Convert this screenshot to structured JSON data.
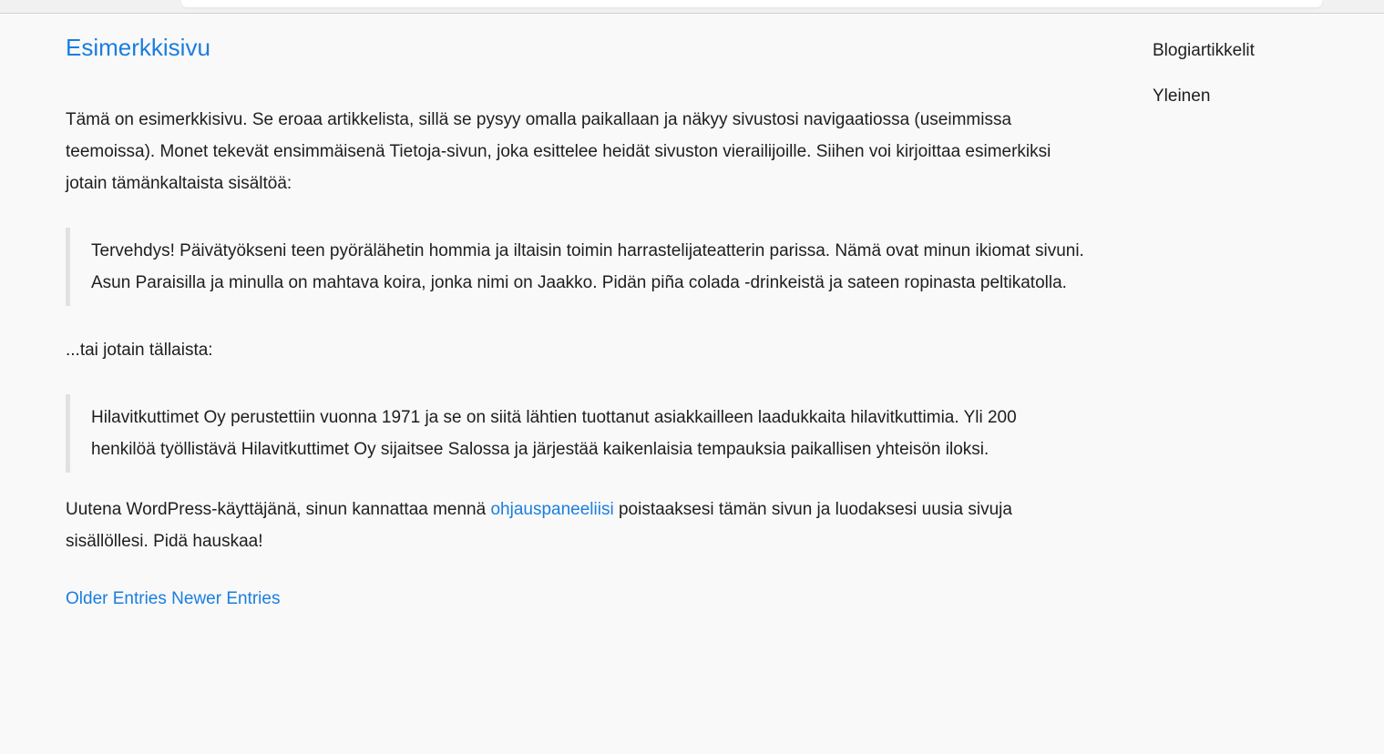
{
  "page": {
    "title": "Esimerkkisivu"
  },
  "content": {
    "intro": "Tämä on esimerkkisivu. Se eroaa artikkelista, sillä se pysyy omalla paikallaan ja näkyy sivustosi navigaatiossa (useimmissa teemoissa). Monet tekevät ensimmäisenä Tietoja-sivun, joka esittelee heidät sivuston vierailijoille. Siihen voi kirjoittaa esimerkiksi jotain tämänkaltaista sisältöä:",
    "quote1": "Tervehdys! Päivätyökseni teen pyörälähetin hommia ja iltaisin toimin harrastelijateatterin parissa. Nämä ovat minun ikiomat sivuni. Asun Paraisilla ja minulla on mahtava koira, jonka nimi on Jaakko. Pidän piña colada -drinkeistä ja sateen ropinasta peltikatolla.",
    "or_text": "...tai jotain tällaista:",
    "quote2": "Hilavitkuttimet Oy perustettiin vuonna 1971 ja se on siitä lähtien tuottanut asiakkailleen laadukkaita hilavitkuttimia. Yli 200 henkilöä työllistävä Hilavitkuttimet Oy sijaitsee Salossa ja järjestää kaikenlaisia tempauksia paikallisen yhteisön iloksi.",
    "outro_before": "Uutena WordPress-käyttäjänä, sinun kannattaa mennä ",
    "outro_link": "ohjauspaneeliisi",
    "outro_after": " poistaaksesi tämän sivun ja luodaksesi uusia sivuja sisällöllesi. Pidä hauskaa!"
  },
  "pagination": {
    "older": "Older Entries",
    "newer": "Newer Entries"
  },
  "sidebar": {
    "items": [
      {
        "label": "Blogiartikkelit"
      },
      {
        "label": "Yleinen"
      }
    ]
  },
  "colors": {
    "link": "#1a7ee0",
    "text": "#1e1e1e",
    "background": "#f9f9f9",
    "quote_border": "#e1e1e1"
  }
}
